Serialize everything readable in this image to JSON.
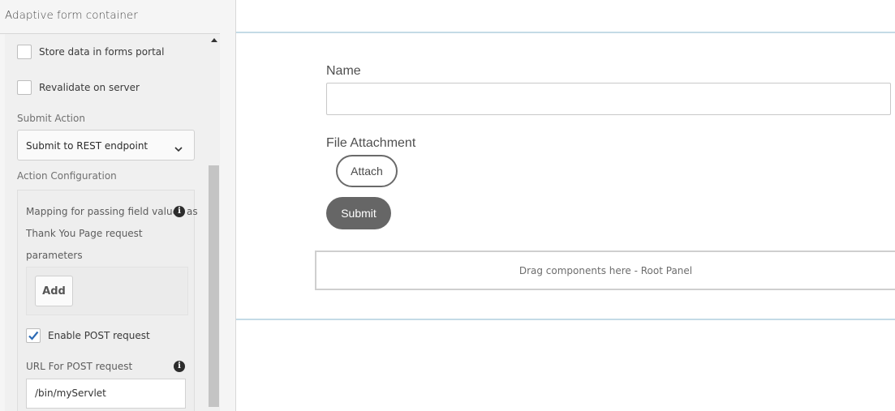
{
  "panel": {
    "title": "Adaptive form container",
    "store_portal": {
      "label": "Store data in forms portal",
      "checked": false
    },
    "revalidate": {
      "label": "Revalidate on server",
      "checked": false
    },
    "submit_action": {
      "label": "Submit Action",
      "value": "Submit to REST endpoint"
    },
    "action_config": {
      "label": "Action Configuration",
      "mapping_line1": "Mapping for passing field values as",
      "mapping_line2": "Thank You Page request",
      "mapping_line3": "parameters",
      "add_label": "Add",
      "enable_post": {
        "label": "Enable POST request",
        "checked": true
      },
      "url_label": "URL For POST request",
      "url_value": "/bin/myServlet"
    },
    "info_glyph": "i"
  },
  "form": {
    "name_label": "Name",
    "name_value": "",
    "file_label": "File Attachment",
    "attach_label": "Attach",
    "submit_label": "Submit",
    "drop_zone_text": "Drag components here - Root Panel"
  },
  "colors": {
    "accent_check": "#2d6bb5",
    "submit_bg": "#666666"
  }
}
